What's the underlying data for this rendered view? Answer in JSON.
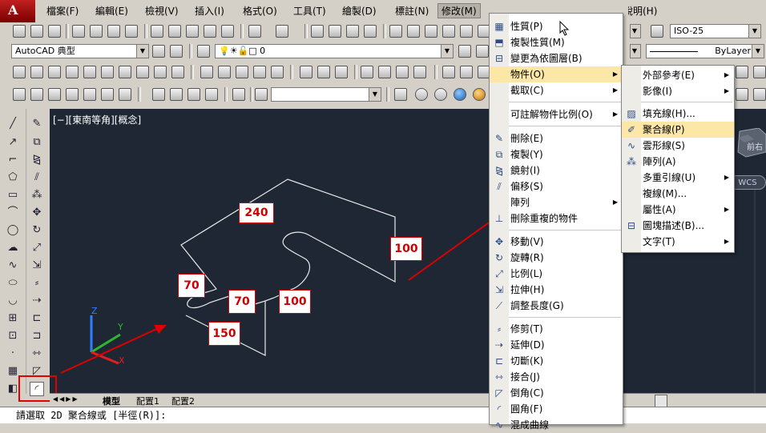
{
  "menubar": {
    "items": [
      "檔案(F)",
      "編輯(E)",
      "檢視(V)",
      "插入(I)",
      "格式(O)",
      "工具(T)",
      "繪製(D)",
      "標註(N)",
      "修改(M)",
      "說明(H)"
    ]
  },
  "toolbar": {
    "workspace_value": "AutoCAD 典型",
    "layer_value": "0",
    "dimstyle_value": "ISO-25",
    "linetype_value": "ByLayer"
  },
  "viewport": {
    "label": "[−][東南等角][概念]",
    "ucs_axes": [
      "X",
      "Y",
      "Z"
    ],
    "viewcube": {
      "text": "前右",
      "wcs": "WCS"
    }
  },
  "dimensions": [
    "240",
    "100",
    "70",
    "70",
    "100",
    "150"
  ],
  "tabs": [
    "模型",
    "配置1",
    "配置2"
  ],
  "command_line": "請選取 2D 聚合線或 [半徑(R)]:",
  "modify_menu": {
    "items": [
      {
        "label": "性質(P)",
        "icon": "properties-icon"
      },
      {
        "label": "複製性質(M)",
        "icon": "match-properties-icon"
      },
      {
        "label": "變更為依圖層(B)",
        "icon": "change-bylayer-icon"
      },
      {
        "label": "物件(O)",
        "submenu": true,
        "highlighted": true
      },
      {
        "label": "截取(C)",
        "submenu": true
      },
      {
        "label": "可註解物件比例(O)",
        "submenu": true
      },
      {
        "label": "刪除(E)",
        "icon": "erase-icon"
      },
      {
        "label": "複製(Y)",
        "icon": "copy-icon"
      },
      {
        "label": "鏡射(I)",
        "icon": "mirror-icon"
      },
      {
        "label": "偏移(S)",
        "icon": "offset-icon"
      },
      {
        "label": "陣列",
        "submenu": true
      },
      {
        "label": "刪除重複的物件",
        "icon": "delete-duplicates-icon"
      },
      {
        "label": "移動(V)",
        "icon": "move-icon"
      },
      {
        "label": "旋轉(R)",
        "icon": "rotate-icon"
      },
      {
        "label": "比例(L)",
        "icon": "scale-icon"
      },
      {
        "label": "拉伸(H)",
        "icon": "stretch-icon"
      },
      {
        "label": "調整長度(G)",
        "icon": "lengthen-icon"
      },
      {
        "label": "修剪(T)",
        "icon": "trim-icon"
      },
      {
        "label": "延伸(D)",
        "icon": "extend-icon"
      },
      {
        "label": "切斷(K)",
        "icon": "break-icon"
      },
      {
        "label": "接合(J)",
        "icon": "join-icon"
      },
      {
        "label": "倒角(C)",
        "icon": "chamfer-icon"
      },
      {
        "label": "圓角(F)",
        "icon": "fillet-icon"
      },
      {
        "label": "混成曲線",
        "icon": "blend-icon"
      }
    ]
  },
  "object_submenu": {
    "items": [
      {
        "label": "外部參考(E)",
        "submenu": true
      },
      {
        "label": "影像(I)",
        "submenu": true
      },
      {
        "label": "填充線(H)...",
        "icon": "hatch-icon"
      },
      {
        "label": "聚合線(P)",
        "icon": "polyline-icon",
        "highlighted": true
      },
      {
        "label": "雲形線(S)",
        "icon": "spline-icon"
      },
      {
        "label": "陣列(A)",
        "icon": "array-icon"
      },
      {
        "label": "多重引線(U)",
        "submenu": true
      },
      {
        "label": "複線(M)..."
      },
      {
        "label": "屬性(A)",
        "submenu": true
      },
      {
        "label": "圖塊描述(B)...",
        "icon": "block-description-icon"
      },
      {
        "label": "文字(T)",
        "submenu": true
      }
    ]
  },
  "colors": {
    "canvas_bg": "#1e2733",
    "highlight_box": "#e00000",
    "menu_highlight": "#fde7a6"
  }
}
